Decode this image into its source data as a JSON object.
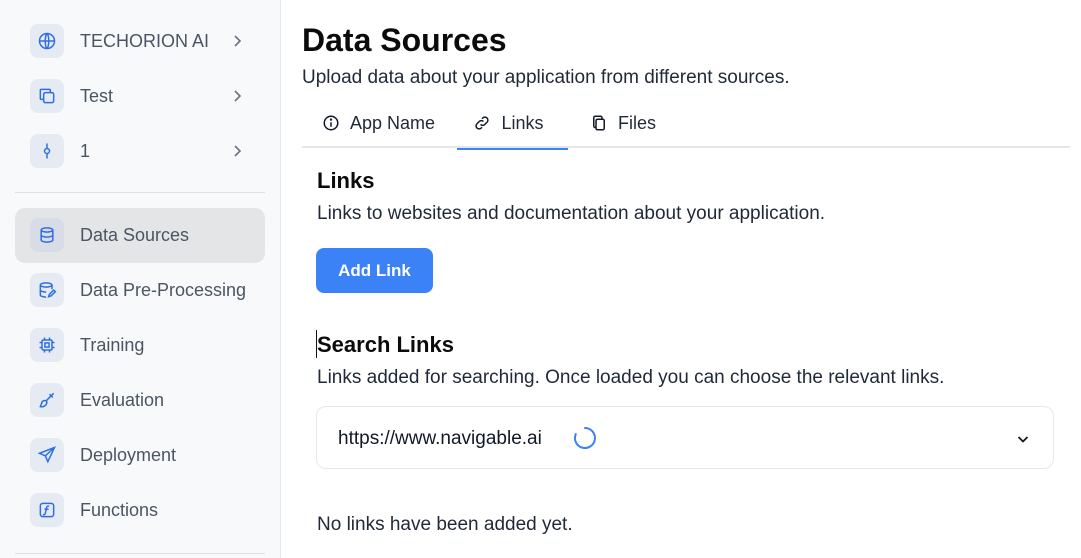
{
  "context": {
    "items": [
      {
        "label": "TECHORION AI",
        "icon": "globe-icon"
      },
      {
        "label": "Test",
        "icon": "copy-icon"
      },
      {
        "label": "1",
        "icon": "commit-icon"
      }
    ]
  },
  "sidebar": {
    "items": [
      {
        "label": "Data Sources",
        "icon": "database-icon",
        "active": true
      },
      {
        "label": "Data Pre-Processing",
        "icon": "database-edit-icon"
      },
      {
        "label": "Training",
        "icon": "cpu-icon"
      },
      {
        "label": "Evaluation",
        "icon": "brush-icon"
      },
      {
        "label": "Deployment",
        "icon": "send-icon"
      },
      {
        "label": "Functions",
        "icon": "function-icon"
      }
    ]
  },
  "main": {
    "title": "Data Sources",
    "subtitle": "Upload data about your application from different sources.",
    "tabs": [
      {
        "label": "App Name",
        "icon": "info-icon"
      },
      {
        "label": "Links",
        "icon": "link-icon",
        "active": true
      },
      {
        "label": "Files",
        "icon": "files-icon"
      }
    ],
    "links_section": {
      "title": "Links",
      "description": "Links to websites and documentation about your application.",
      "add_button": "Add Link"
    },
    "search_section": {
      "title": "Search Links",
      "description": "Links added for searching. Once loaded you can choose the relevant links.",
      "selected_value": "https://www.navigable.ai"
    },
    "empty_message": "No links have been added yet."
  },
  "colors": {
    "accent": "#3b82f6",
    "icon_blue": "#2f6fe0",
    "sidebar_bg": "#f8f9fa",
    "active_item_bg": "#e4e5e7"
  }
}
